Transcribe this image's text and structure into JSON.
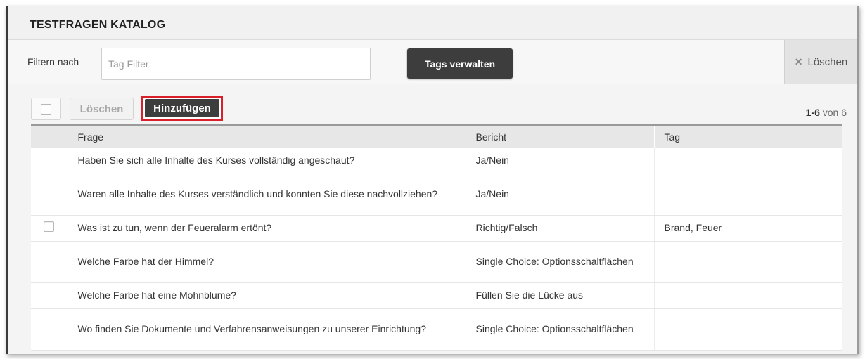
{
  "page": {
    "title": "TESTFRAGEN KATALOG"
  },
  "filter": {
    "label": "Filtern nach",
    "placeholder": "Tag Filter",
    "value": "",
    "manage_tags_label": "Tags verwalten",
    "clear_label": "Löschen",
    "clear_icon": "close-icon"
  },
  "toolbar": {
    "delete_label": "Löschen",
    "add_label": "Hinzufügen"
  },
  "pagination": {
    "range": "1-6",
    "of_text": "von 6"
  },
  "table": {
    "columns": [
      "Frage",
      "Bericht",
      "Tag"
    ],
    "rows": [
      {
        "frage": "Haben Sie sich alle Inhalte des Kurses vollständig angeschaut?",
        "bericht": "Ja/Nein",
        "tag": "",
        "has_checkbox": false
      },
      {
        "frage": "Waren alle Inhalte des Kurses verständlich und konnten Sie diese nachvollziehen?",
        "bericht": "Ja/Nein",
        "tag": "",
        "has_checkbox": false
      },
      {
        "frage": "Was ist zu tun, wenn der Feueralarm ertönt?",
        "bericht": "Richtig/Falsch",
        "tag": "Brand, Feuer",
        "has_checkbox": true
      },
      {
        "frage": "Welche Farbe hat der Himmel?",
        "bericht": "Single Choice: Optionsschaltflächen",
        "tag": "",
        "has_checkbox": false
      },
      {
        "frage": "Welche Farbe hat eine Mohnblume?",
        "bericht": "Füllen Sie die Lücke aus",
        "tag": "",
        "has_checkbox": false
      },
      {
        "frage": "Wo finden Sie Dokumente und Verfahrensanweisungen zu unserer Einrichtung?",
        "bericht": "Single Choice: Optionsschaltflächen",
        "tag": "",
        "has_checkbox": false
      }
    ]
  },
  "colors": {
    "accent_dark_button": "#3d3d3d",
    "highlight_outline": "#d9202a"
  }
}
